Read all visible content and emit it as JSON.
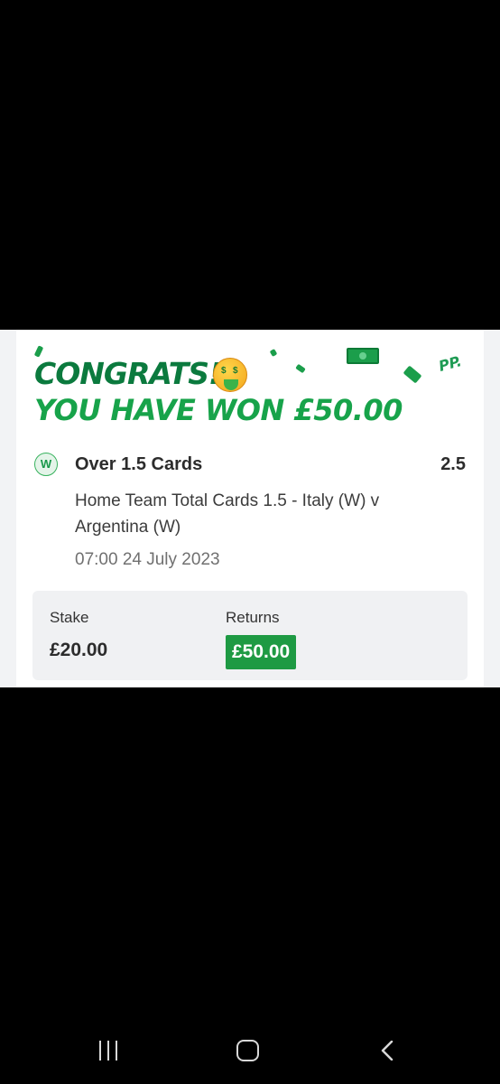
{
  "banner": {
    "title": "CONGRATS!",
    "emoji": "money-mouth-face",
    "subtitle": "YOU HAVE WON £50.00",
    "brand_mark": "PP."
  },
  "bet": {
    "status_badge": "W",
    "selection": "Over 1.5 Cards",
    "odds": "2.5",
    "market": "Home Team Total Cards 1.5 - Italy (W) v Argentina (W)",
    "datetime": "07:00 24 July 2023"
  },
  "summary": {
    "stake_label": "Stake",
    "stake_value": "£20.00",
    "returns_label": "Returns",
    "returns_value": "£50.00"
  },
  "navbar": {
    "recents_icon": "recents-icon",
    "home_icon": "home-icon",
    "back_icon": "back-icon"
  },
  "colors": {
    "title_green": "#0b7a3e",
    "win_green": "#17a34a",
    "returns_bg": "#1e9a43"
  }
}
